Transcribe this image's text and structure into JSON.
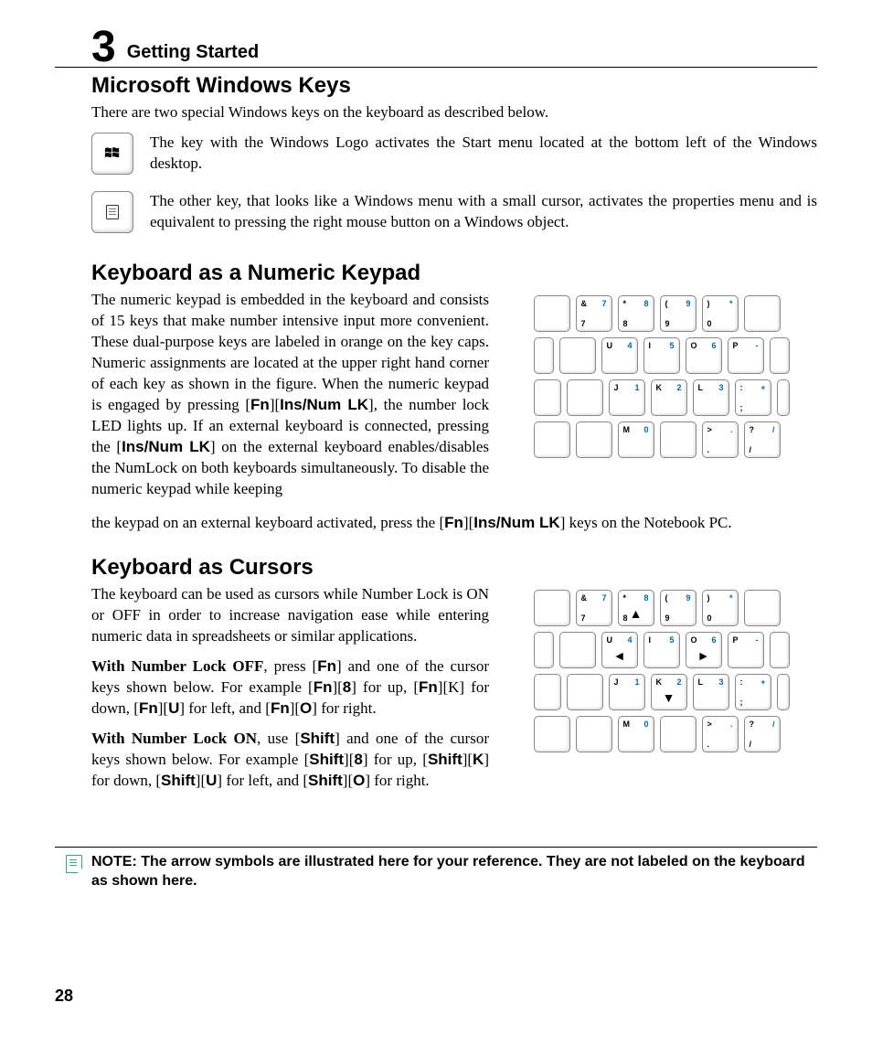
{
  "chapter": {
    "num": "3",
    "title": "Getting Started"
  },
  "h_windows": "Microsoft Windows Keys",
  "p_windows_intro": "There are two special Windows keys on the keyboard as described below.",
  "p_winlogo": "The key with the Windows Logo activates the Start menu located at the bottom left of the Windows desktop.",
  "p_winmenu": "The other key, that looks like a Windows menu with a small cursor, activates the properties menu and is equivalent to pressing the right mouse button on a Windows object.",
  "h_numpad": "Keyboard as a Numeric Keypad",
  "numpad_p1a": "The numeric keypad is embedded in the keyboard and consists of 15 keys that make number intensive input more convenient. These dual-purpose keys are labeled in orange on the key caps. Numeric assignments are located at the upper right hand corner of each key as shown in the figure. When the numeric keypad is engaged by pressing [",
  "numpad_fn": "Fn",
  "numpad_p1b": "][",
  "numpad_ins": "Ins/Num LK",
  "numpad_p1c": "], the number lock LED lights up. If an external keyboard is connected, pressing the [",
  "numpad_p1d": "] on the external keyboard enables/disables the NumLock on both keyboards simultaneously. To disable the numeric keypad while keeping",
  "numpad_p2a": "the keypad on an external keyboard activated, press the  [",
  "numpad_p2b": "][",
  "numpad_p2c": "] keys on the Notebook PC.",
  "h_cursors": "Keyboard as Cursors",
  "cursor_p1": "The keyboard can be used as cursors while Number Lock is ON or OFF in order to increase navigation ease while entering numeric data in spreadsheets or similar applications.",
  "cursor_p2_lead": "With Number Lock OFF",
  "cursor_p2a": ", press [",
  "cursor_p2b": "] and one of the cursor keys shown below. For example [",
  "cursor_p2c": "][",
  "cursor_p2d": "] for up, [",
  "cursor_p2e": "][K] for down, [",
  "cursor_p2f": "][",
  "cursor_p2g": "] for left, and [",
  "cursor_p2h": "][",
  "cursor_p2i": "] for right.",
  "k8": "8",
  "kU": "U",
  "kO": "O",
  "kK": "K",
  "kShift": "Shift",
  "cursor_p3_lead": "With Number Lock ON",
  "cursor_p3a": ", use [",
  "cursor_p3b": "] and one of the cursor keys shown below. For example [",
  "cursor_p3c": "][",
  "cursor_p3d": "] for up, [",
  "cursor_p3e": "][",
  "cursor_p3f": "] for down, [",
  "cursor_p3g": "][",
  "cursor_p3h": "] for left, and [",
  "cursor_p3i": "][",
  "cursor_p3j": "] for right.",
  "note": "NOTE: The arrow symbols are illustrated here for your reference. They are not labeled on the keyboard as shown here.",
  "page_num": "28",
  "keys_row1": [
    {
      "tl": "&",
      "tnum": "7",
      "bl": "7"
    },
    {
      "tl": "*",
      "tnum": "8",
      "bl": "8"
    },
    {
      "tl": "(",
      "tnum": "9",
      "bl": "9"
    },
    {
      "tl": ")",
      "tnum": "*",
      "bl": "0"
    }
  ],
  "keys_row2": [
    {
      "tl": "U",
      "tnum": "4",
      "bl": ""
    },
    {
      "tl": "I",
      "tnum": "5",
      "bl": ""
    },
    {
      "tl": "O",
      "tnum": "6",
      "bl": ""
    },
    {
      "tl": "P",
      "tnum": "-",
      "bl": ""
    }
  ],
  "keys_row3": [
    {
      "tl": "J",
      "tnum": "1",
      "bl": ""
    },
    {
      "tl": "K",
      "tnum": "2",
      "bl": ""
    },
    {
      "tl": "L",
      "tnum": "3",
      "bl": ""
    },
    {
      "tl": ":",
      "tnum": "+",
      "bl": ";"
    }
  ],
  "keys_row4": [
    {
      "tl": "M",
      "tnum": "0",
      "bl": ""
    },
    {
      "tl": ">",
      "tnum": ".",
      "bl": "."
    },
    {
      "tl": "?",
      "tnum": "/",
      "bl": "/"
    }
  ]
}
